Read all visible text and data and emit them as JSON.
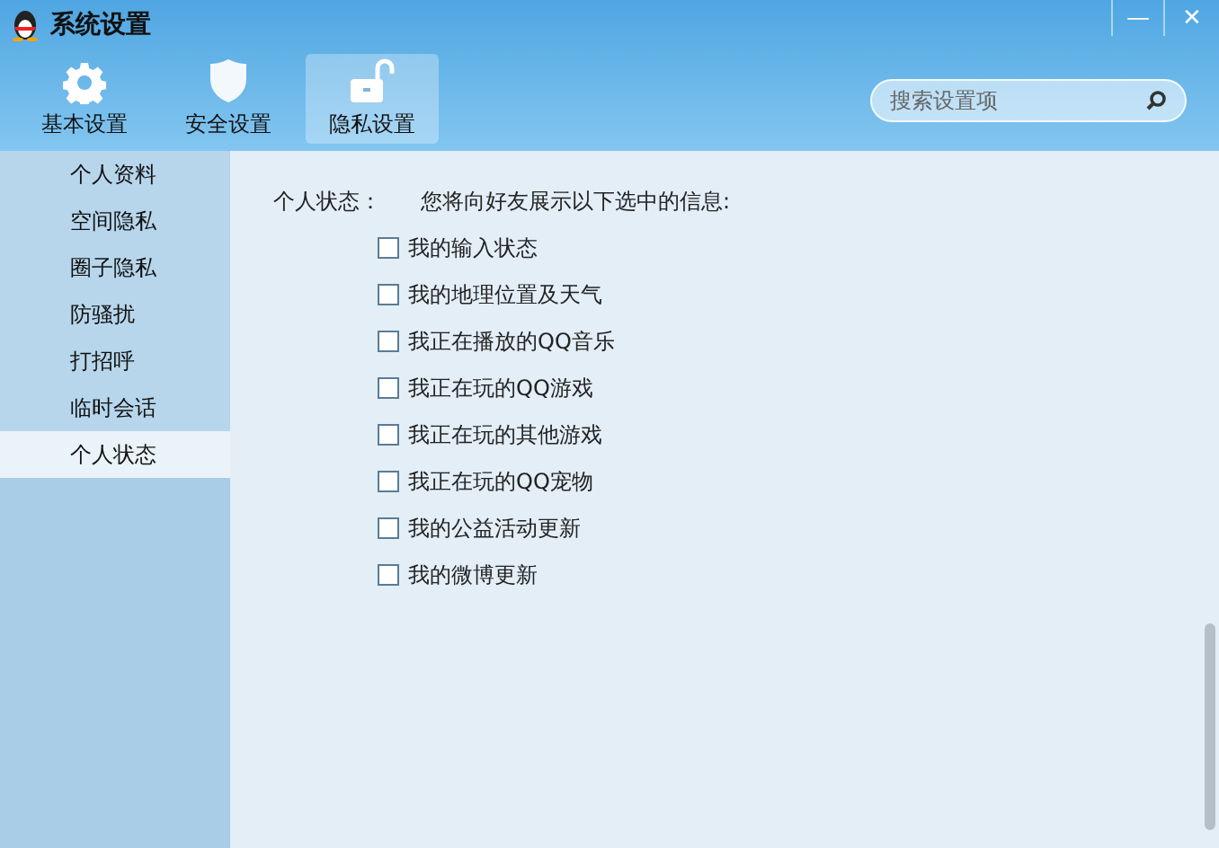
{
  "window": {
    "title": "系统设置",
    "minimize": "—",
    "close": "✕"
  },
  "toolbar": [
    {
      "kind": "gear",
      "label": "基本设置",
      "selected": false
    },
    {
      "kind": "shield",
      "label": "安全设置",
      "selected": false
    },
    {
      "kind": "lock",
      "label": "隐私设置",
      "selected": true
    }
  ],
  "search": {
    "placeholder": "搜索设置项"
  },
  "sidebar": {
    "items": [
      {
        "label": "个人资料",
        "selected": false
      },
      {
        "label": "空间隐私",
        "selected": false
      },
      {
        "label": "圈子隐私",
        "selected": false
      },
      {
        "label": "防骚扰",
        "selected": false
      },
      {
        "label": "打招呼",
        "selected": false
      },
      {
        "label": "临时会话",
        "selected": false
      },
      {
        "label": "个人状态",
        "selected": true
      }
    ]
  },
  "section": {
    "label": "个人状态：",
    "description": "您将向好友展示以下选中的信息:",
    "options": [
      {
        "label": "我的输入状态",
        "checked": false
      },
      {
        "label": "我的地理位置及天气",
        "checked": false
      },
      {
        "label": "我正在播放的QQ音乐",
        "checked": false
      },
      {
        "label": "我正在玩的QQ游戏",
        "checked": false
      },
      {
        "label": "我正在玩的其他游戏",
        "checked": false
      },
      {
        "label": "我正在玩的QQ宠物",
        "checked": false
      },
      {
        "label": "我的公益活动更新",
        "checked": false
      },
      {
        "label": "我的微博更新",
        "checked": false
      }
    ]
  }
}
